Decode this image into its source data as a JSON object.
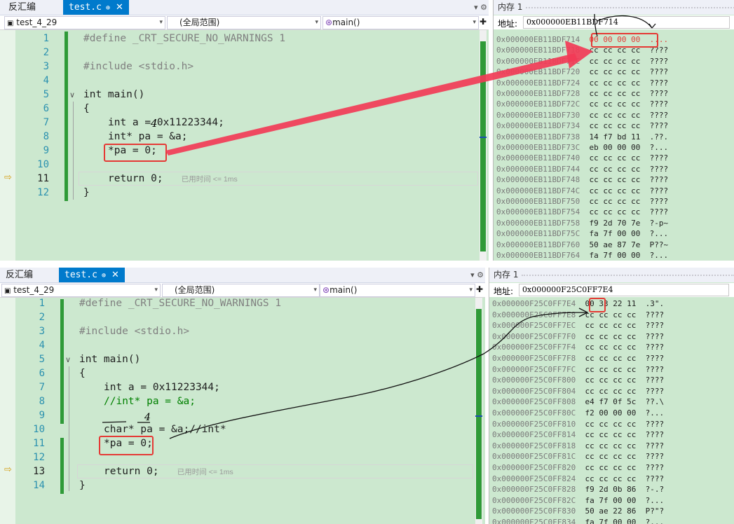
{
  "top": {
    "tabs": {
      "disasm": "反汇编",
      "file": "test.c",
      "pin": "⊕",
      "close": "✕"
    },
    "nav": {
      "project": "test_4_29",
      "scope": "(全局范围)",
      "func": "main()"
    },
    "lines": [
      {
        "num": "1",
        "text": "#define _CRT_SECURE_NO_WARNINGS 1"
      },
      {
        "num": "2",
        "text": ""
      },
      {
        "num": "3",
        "text": "#include <stdio.h>"
      },
      {
        "num": "4",
        "text": ""
      },
      {
        "num": "5",
        "text": "int main()"
      },
      {
        "num": "6",
        "text": "{"
      },
      {
        "num": "7",
        "text": "int a = 0x11223344;"
      },
      {
        "num": "8",
        "text": "int* pa = &a;"
      },
      {
        "num": "9",
        "text": "*pa = 0;"
      },
      {
        "num": "10",
        "text": ""
      },
      {
        "num": "11",
        "text": "return 0;"
      },
      {
        "num": "12",
        "text": "}"
      }
    ],
    "elapsed_hint": "已用时间 <= 1ms",
    "annotation_4": "4",
    "memory": {
      "title": "内存 1",
      "addr_label": "地址:",
      "addr_value": "0x000000EB11BDF714",
      "rows": [
        {
          "addr": "0x000000EB11BDF714",
          "bytes": "00 00 00 00",
          "chars": "...."
        },
        {
          "addr": "0x000000EB11BDF718",
          "bytes": "cc cc cc cc",
          "chars": "????"
        },
        {
          "addr": "0x000000EB11BDF71C",
          "bytes": "cc cc cc cc",
          "chars": "????"
        },
        {
          "addr": "0x000000EB11BDF720",
          "bytes": "cc cc cc cc",
          "chars": "????"
        },
        {
          "addr": "0x000000EB11BDF724",
          "bytes": "cc cc cc cc",
          "chars": "????"
        },
        {
          "addr": "0x000000EB11BDF728",
          "bytes": "cc cc cc cc",
          "chars": "????"
        },
        {
          "addr": "0x000000EB11BDF72C",
          "bytes": "cc cc cc cc",
          "chars": "????"
        },
        {
          "addr": "0x000000EB11BDF730",
          "bytes": "cc cc cc cc",
          "chars": "????"
        },
        {
          "addr": "0x000000EB11BDF734",
          "bytes": "cc cc cc cc",
          "chars": "????"
        },
        {
          "addr": "0x000000EB11BDF738",
          "bytes": "14 f7 bd 11",
          "chars": ".??."
        },
        {
          "addr": "0x000000EB11BDF73C",
          "bytes": "eb 00 00 00",
          "chars": "?..."
        },
        {
          "addr": "0x000000EB11BDF740",
          "bytes": "cc cc cc cc",
          "chars": "????"
        },
        {
          "addr": "0x000000EB11BDF744",
          "bytes": "cc cc cc cc",
          "chars": "????"
        },
        {
          "addr": "0x000000EB11BDF748",
          "bytes": "cc cc cc cc",
          "chars": "????"
        },
        {
          "addr": "0x000000EB11BDF74C",
          "bytes": "cc cc cc cc",
          "chars": "????"
        },
        {
          "addr": "0x000000EB11BDF750",
          "bytes": "cc cc cc cc",
          "chars": "????"
        },
        {
          "addr": "0x000000EB11BDF754",
          "bytes": "cc cc cc cc",
          "chars": "????"
        },
        {
          "addr": "0x000000EB11BDF758",
          "bytes": "f9 2d 70 7e",
          "chars": "?-p~"
        },
        {
          "addr": "0x000000EB11BDF75C",
          "bytes": "fa 7f 00 00",
          "chars": "?..."
        },
        {
          "addr": "0x000000EB11BDF760",
          "bytes": "50 ae 87 7e",
          "chars": "P??~"
        },
        {
          "addr": "0x000000EB11BDF764",
          "bytes": "fa 7f 00 00",
          "chars": "?..."
        }
      ]
    }
  },
  "bottom": {
    "tabs": {
      "disasm": "反汇编",
      "file": "test.c",
      "pin": "⊕",
      "close": "✕"
    },
    "nav": {
      "project": "test_4_29",
      "scope": "(全局范围)",
      "func": "main()"
    },
    "lines": [
      {
        "num": "1",
        "text": "#define _CRT_SECURE_NO_WARNINGS 1"
      },
      {
        "num": "2",
        "text": ""
      },
      {
        "num": "3",
        "text": "#include <stdio.h>"
      },
      {
        "num": "4",
        "text": ""
      },
      {
        "num": "5",
        "text": "int main()"
      },
      {
        "num": "6",
        "text": "{"
      },
      {
        "num": "7",
        "text": "int a = 0x11223344;"
      },
      {
        "num": "8",
        "text": "//int* pa = &a;"
      },
      {
        "num": "9",
        "text": ""
      },
      {
        "num": "10",
        "text": "char* pa = &a;//int*"
      },
      {
        "num": "11",
        "text": "*pa = 0;"
      },
      {
        "num": "12",
        "text": ""
      },
      {
        "num": "13",
        "text": "return 0;"
      },
      {
        "num": "14",
        "text": "}"
      }
    ],
    "elapsed_hint": "已用时间 <= 1ms",
    "annotation_4": "4",
    "memory": {
      "title": "内存 1",
      "addr_label": "地址:",
      "addr_value": "0x000000F25C0FF7E4",
      "rows": [
        {
          "addr": "0x000000F25C0FF7E4",
          "bytes": "00 33 22 11",
          "chars": ".3\"."
        },
        {
          "addr": "0x000000F25C0FF7E8",
          "bytes": "cc cc cc cc",
          "chars": "????"
        },
        {
          "addr": "0x000000F25C0FF7EC",
          "bytes": "cc cc cc cc",
          "chars": "????"
        },
        {
          "addr": "0x000000F25C0FF7F0",
          "bytes": "cc cc cc cc",
          "chars": "????"
        },
        {
          "addr": "0x000000F25C0FF7F4",
          "bytes": "cc cc cc cc",
          "chars": "????"
        },
        {
          "addr": "0x000000F25C0FF7F8",
          "bytes": "cc cc cc cc",
          "chars": "????"
        },
        {
          "addr": "0x000000F25C0FF7FC",
          "bytes": "cc cc cc cc",
          "chars": "????"
        },
        {
          "addr": "0x000000F25C0FF800",
          "bytes": "cc cc cc cc",
          "chars": "????"
        },
        {
          "addr": "0x000000F25C0FF804",
          "bytes": "cc cc cc cc",
          "chars": "????"
        },
        {
          "addr": "0x000000F25C0FF808",
          "bytes": "e4 f7 0f 5c",
          "chars": "??.\\"
        },
        {
          "addr": "0x000000F25C0FF80C",
          "bytes": "f2 00 00 00",
          "chars": "?..."
        },
        {
          "addr": "0x000000F25C0FF810",
          "bytes": "cc cc cc cc",
          "chars": "????"
        },
        {
          "addr": "0x000000F25C0FF814",
          "bytes": "cc cc cc cc",
          "chars": "????"
        },
        {
          "addr": "0x000000F25C0FF818",
          "bytes": "cc cc cc cc",
          "chars": "????"
        },
        {
          "addr": "0x000000F25C0FF81C",
          "bytes": "cc cc cc cc",
          "chars": "????"
        },
        {
          "addr": "0x000000F25C0FF820",
          "bytes": "cc cc cc cc",
          "chars": "????"
        },
        {
          "addr": "0x000000F25C0FF824",
          "bytes": "cc cc cc cc",
          "chars": "????"
        },
        {
          "addr": "0x000000F25C0FF828",
          "bytes": "f9 2d 0b 86",
          "chars": "?-.?"
        },
        {
          "addr": "0x000000F25C0FF82C",
          "bytes": "fa 7f 00 00",
          "chars": "?..."
        },
        {
          "addr": "0x000000F25C0FF830",
          "bytes": "50 ae 22 86",
          "chars": "P?\"?"
        },
        {
          "addr": "0x000000F25C0FF834",
          "bytes": "fa 7f 00 00",
          "chars": "?..."
        }
      ]
    }
  },
  "colors": {
    "accent": "#007acc",
    "highlight": "#e53935",
    "background": "#cce8cf"
  }
}
